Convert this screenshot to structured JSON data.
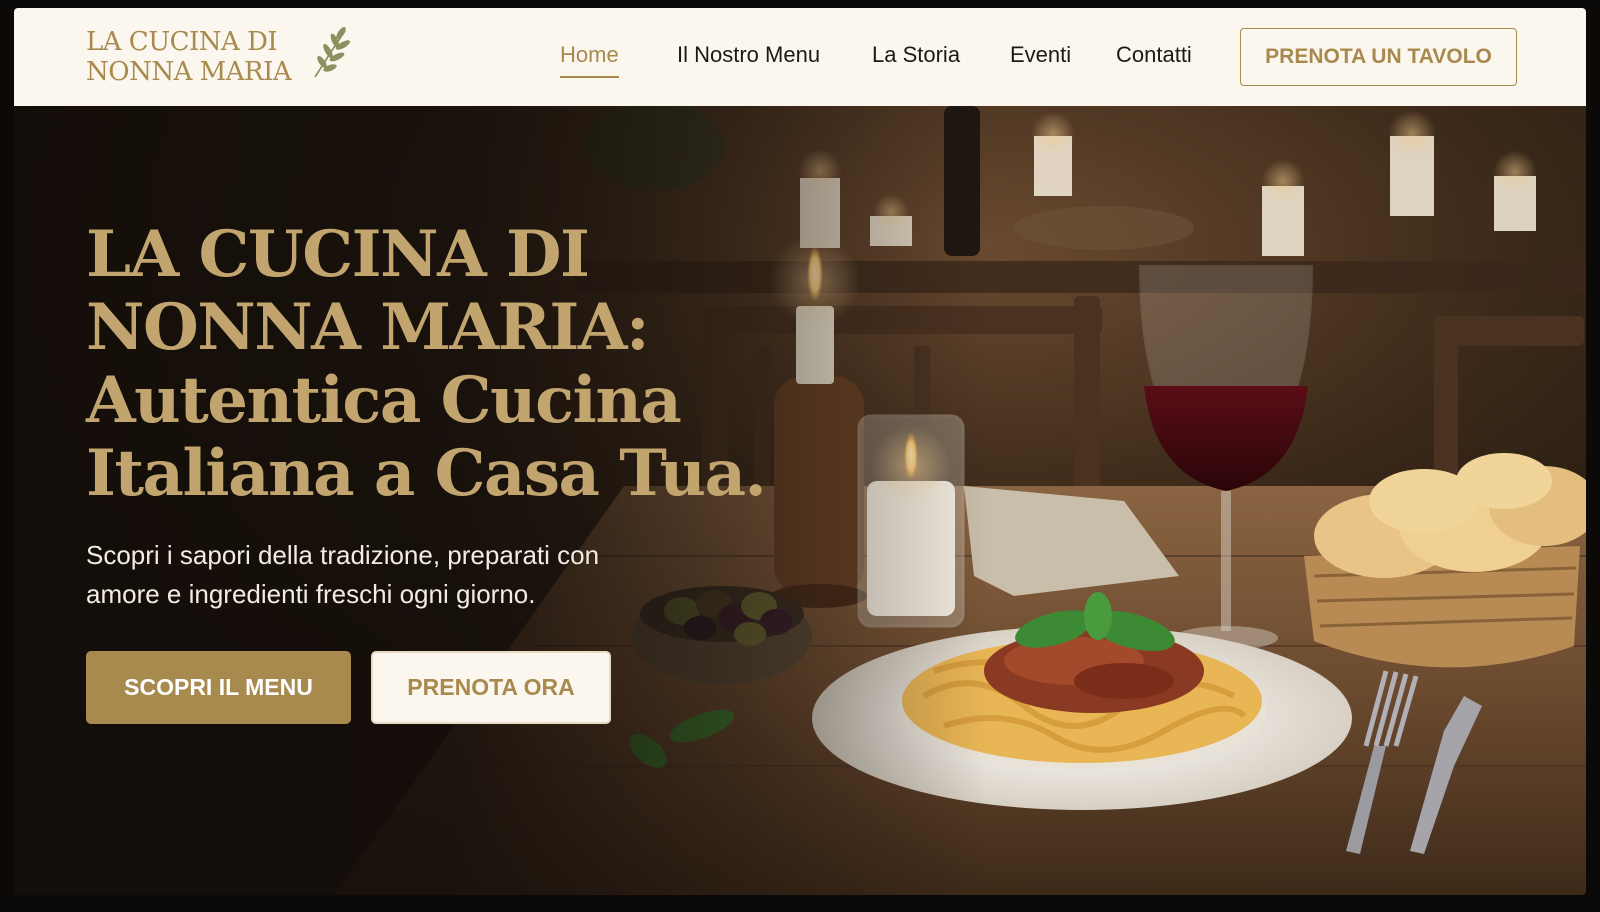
{
  "brand": {
    "logo_line1": "LA CUCINA DI",
    "logo_line2": "NONNA MARIA",
    "logo_icon": "olive-branch-icon",
    "accent_color": "#a88a4e",
    "nav_background": "#fbf7ee"
  },
  "nav": {
    "items": [
      {
        "label": "Home",
        "active": true
      },
      {
        "label": "Il Nostro Menu",
        "active": false
      },
      {
        "label": "La Storia",
        "active": false
      },
      {
        "label": "Eventi",
        "active": false
      },
      {
        "label": "Contatti",
        "active": false
      }
    ],
    "cta_label": "PRENOTA UN TAVOLO"
  },
  "hero": {
    "headline_lines": [
      "LA CUCINA DI",
      "NONNA MARIA:",
      "Autentica Cucina",
      "Italiana a Casa Tua."
    ],
    "subhead_lines": [
      "Scopri i sapori della tradizione, preparati con",
      "amore e ingredienti freschi ogni giorno."
    ],
    "primary_button": "SCOPRI IL MENU",
    "secondary_button": "PRENOTA ORA",
    "background_image": "candlelit rustic table with pasta, red wine, olives and focaccia"
  }
}
